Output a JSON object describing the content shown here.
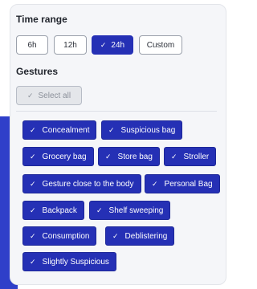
{
  "time_range": {
    "title": "Time range",
    "options": [
      "6h",
      "12h",
      "24h",
      "Custom"
    ],
    "selected": "24h"
  },
  "gestures": {
    "title": "Gestures",
    "select_all_label": "Select all",
    "items": [
      "Concealment",
      "Suspicious bag",
      "Grocery bag",
      "Store bag",
      "Stroller",
      "Gesture close to the body",
      "Personal Bag",
      "Backpack",
      "Shelf sweeping",
      "Consumption",
      "Deblistering",
      "Slightly Suspicious"
    ]
  },
  "icons": {
    "check": "check-icon"
  },
  "colors": {
    "accent": "#2530b5",
    "card_bg": "#f5f6f9",
    "side_panel": "#2f3fc9"
  }
}
